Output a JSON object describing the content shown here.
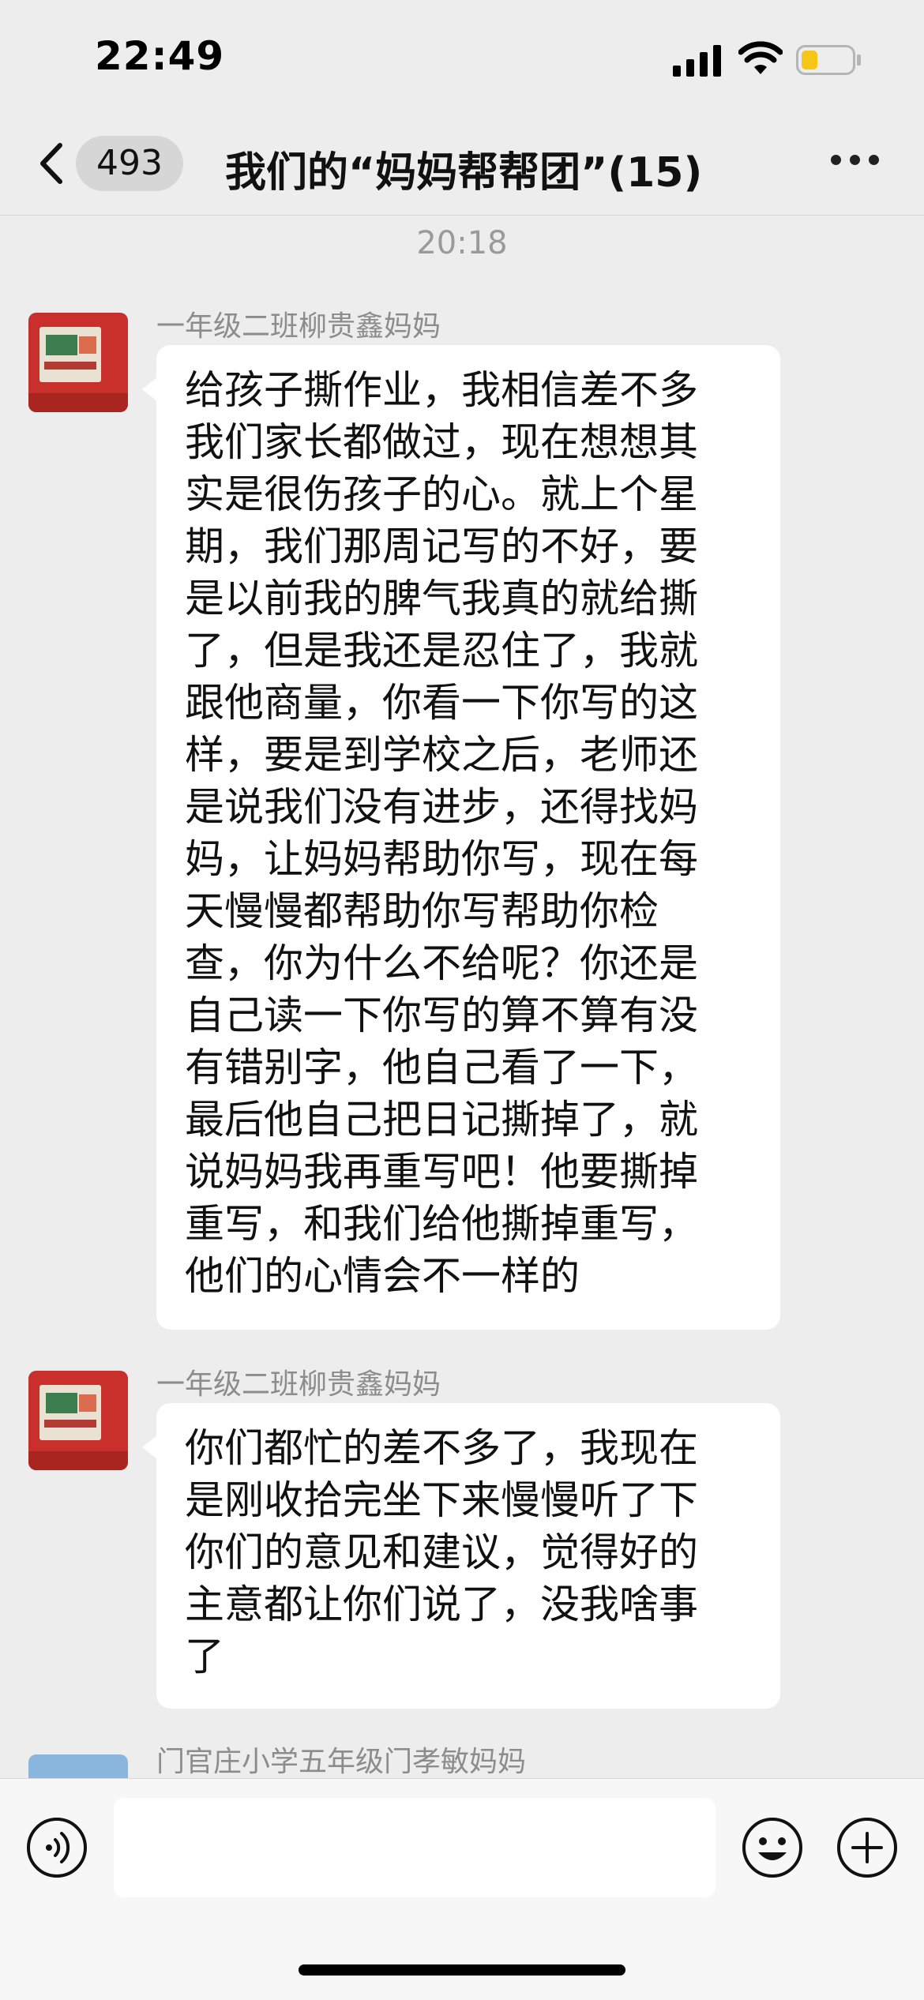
{
  "status_bar": {
    "time": "22:49"
  },
  "nav": {
    "unread_count": "493",
    "title": "我们的“妈妈帮帮团”(15)"
  },
  "timestamp": "20:18",
  "messages": [
    {
      "sender": "一年级二班柳贵鑫妈妈",
      "lines": [
        "给孩子撕作业，我相信差不多",
        "我们家长都做过，现在想想其",
        "实是很伤孩子的心。就上个星",
        "期，我们那周记写的不好，要",
        "是以前我的脾气我真的就给撕",
        "了，但是我还是忍住了，我就",
        "跟他商量，你看一下你写的这",
        "样，要是到学校之后，老师还",
        "是说我们没有进步，还得找妈",
        "妈，让妈妈帮助你写，现在每",
        "天慢慢都帮助你写帮助你检",
        "查，你为什么不给呢？你还是",
        "自己读一下你写的算不算有没",
        "有错别字，他自己看了一下，",
        "最后他自己把日记撕掉了，就",
        "说妈妈我再重写吧！他要撕掉",
        "重写，和我们给他撕掉重写，",
        "他们的心情会不一样的"
      ]
    },
    {
      "sender": "一年级二班柳贵鑫妈妈",
      "lines": [
        "你们都忙的差不多了，我现在",
        "是刚收拾完坐下来慢慢听了下",
        "你们的意见和建议，觉得好的",
        "主意都让你们说了，没我啥事",
        "了"
      ]
    },
    {
      "sender": "门官庄小学五年级门孝敏妈妈"
    }
  ],
  "icons": {
    "back": "chevron-left-icon",
    "more": "ellipsis-icon",
    "voice": "voice-icon",
    "emoji": "emoji-icon",
    "plus": "plus-icon"
  },
  "colors": {
    "background": "#ededed",
    "bubble": "#ffffff",
    "battery_low": "#f5c518"
  }
}
